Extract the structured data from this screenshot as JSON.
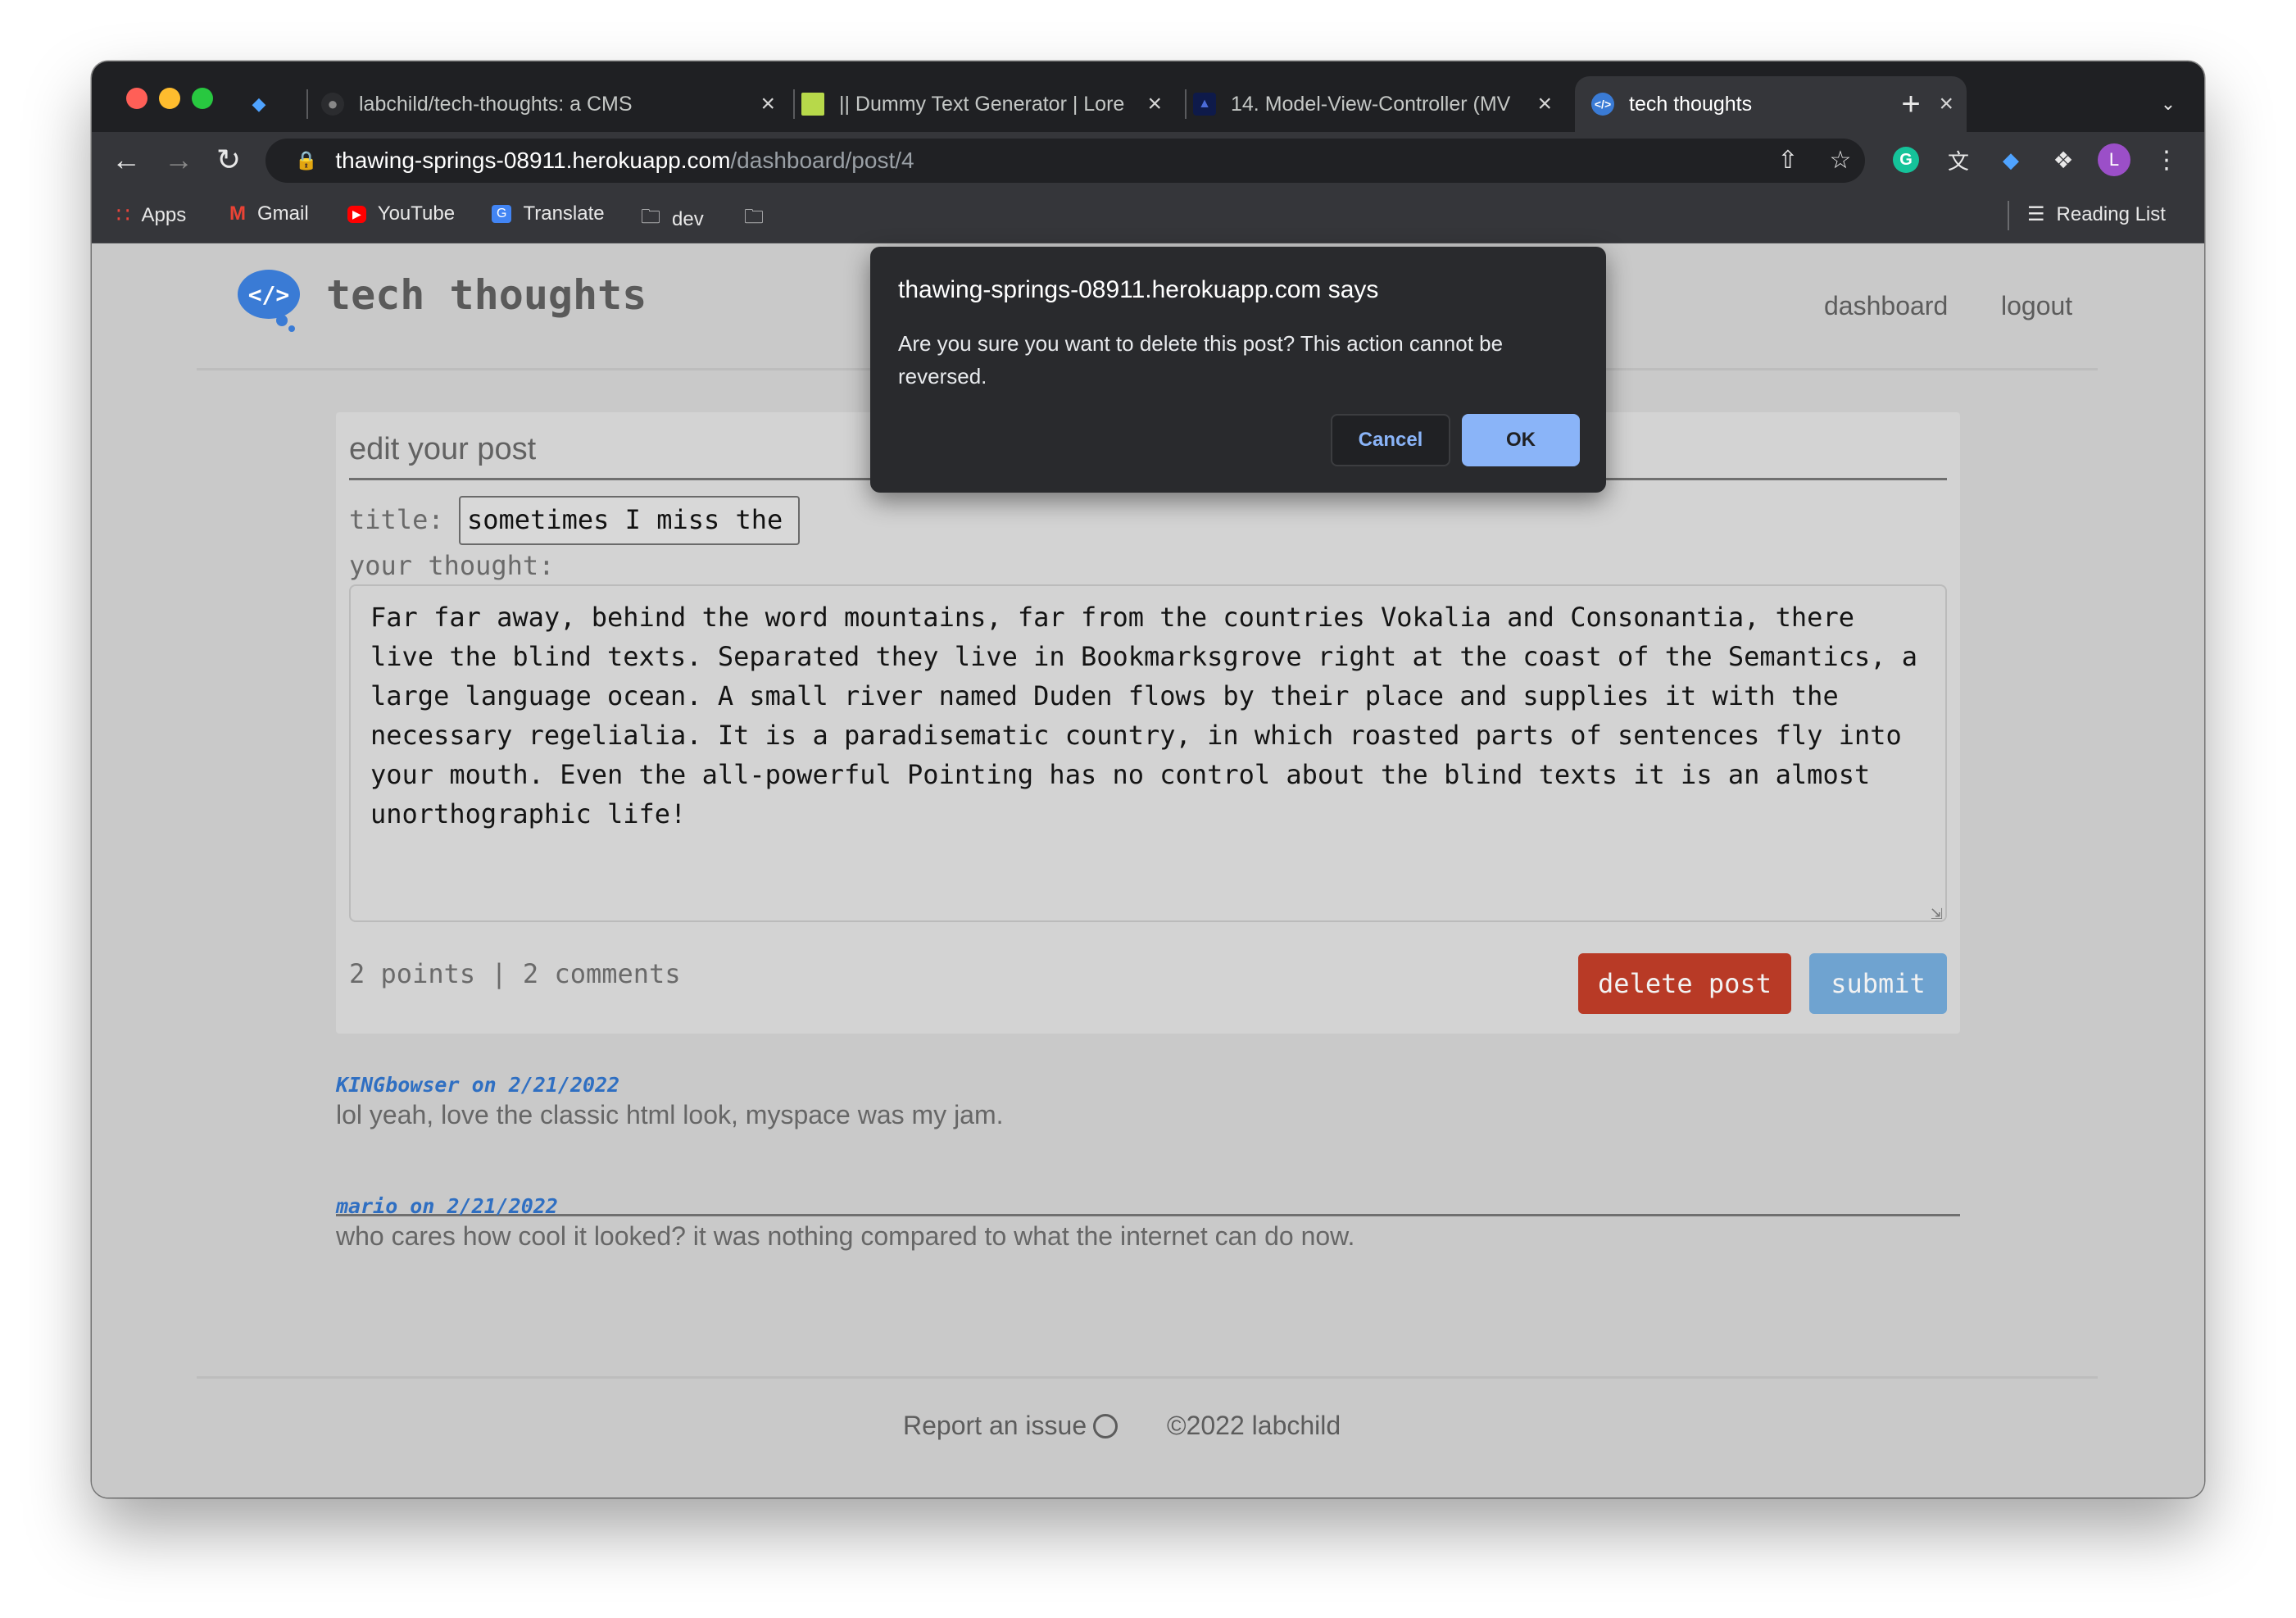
{
  "browser": {
    "tabs": [
      {
        "title": "labchild/tech-thoughts: a CMS",
        "favicon": "github-icon"
      },
      {
        "title": "|| Dummy Text Generator | Lore",
        "favicon": "dummy-text-icon"
      },
      {
        "title": "14. Model-View-Controller (MV",
        "favicon": "course-icon"
      },
      {
        "title": "tech thoughts",
        "favicon": "tech-thoughts-icon",
        "active": true
      }
    ],
    "url_host": "thawing-springs-08911.herokuapp.com",
    "url_path": "/dashboard/post/4",
    "profile_initial": "L",
    "bookmarks": [
      "Apps",
      "Gmail",
      "YouTube",
      "Translate",
      "dev"
    ],
    "reading_list": "Reading List"
  },
  "site": {
    "brand": "tech thoughts",
    "nav": [
      "dashboard",
      "logout"
    ]
  },
  "editor": {
    "heading": "edit your post",
    "title_label": "title:",
    "title_value": "sometimes I miss the",
    "body_label": "your thought:",
    "body_value": "Far far away, behind the word mountains, far from the countries Vokalia and Consonantia, there live the blind texts. Separated they live in Bookmarksgrove right at the coast of the Semantics, a large language ocean. A small river named Duden flows by their place and supplies it with the necessary regelialia. It is a paradisematic country, in which roasted parts of sentences fly into your mouth. Even the all-powerful Pointing has no control about the blind texts it is an almost unorthographic life!",
    "stats": "2 points | 2 comments",
    "delete_label": "delete post",
    "submit_label": "submit"
  },
  "comments": [
    {
      "meta": "KINGbowser on 2/21/2022",
      "text": "lol yeah, love the classic html look, myspace was my jam."
    },
    {
      "meta": "mario on 2/21/2022",
      "text": "who cares how cool it looked? it was nothing compared to what the internet can do now."
    }
  ],
  "footer": {
    "report": "Report an issue",
    "copyright": "©2022 labchild"
  },
  "dialog": {
    "title": "thawing-springs-08911.herokuapp.com says",
    "message": "Are you sure you want to delete this post? This action cannot be reversed.",
    "cancel": "Cancel",
    "ok": "OK"
  },
  "colors": {
    "accent_blue": "#3a7bd5",
    "delete_red": "#e0432a",
    "submit_blue": "#6fa3d0",
    "dialog_ok": "#8ab4f8"
  }
}
